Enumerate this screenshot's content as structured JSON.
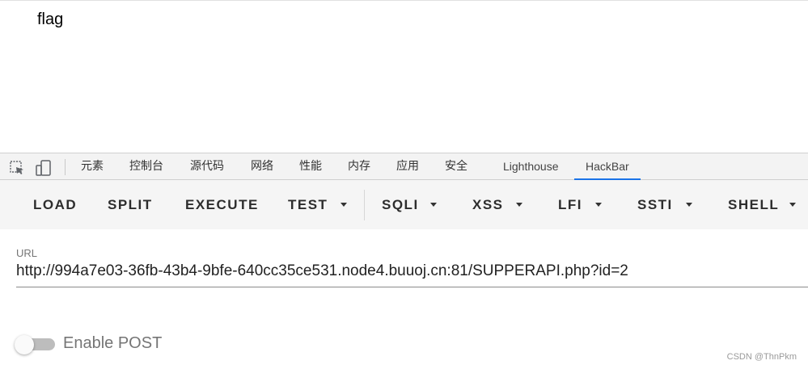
{
  "page": {
    "content_text": "flag"
  },
  "devtools": {
    "icons": [
      "inspect-element-icon",
      "device-toolbar-icon"
    ],
    "tabs": [
      {
        "label": "元素"
      },
      {
        "label": "控制台"
      },
      {
        "label": "源代码"
      },
      {
        "label": "网络"
      },
      {
        "label": "性能"
      },
      {
        "label": "内存"
      },
      {
        "label": "应用"
      },
      {
        "label": "安全"
      },
      {
        "label": "Lighthouse"
      },
      {
        "label": "HackBar",
        "active": true
      }
    ],
    "accent_color": "#1a73e8"
  },
  "hackbar": {
    "buttons": [
      {
        "label": "LOAD"
      },
      {
        "label": "SPLIT"
      },
      {
        "label": "EXECUTE"
      },
      {
        "label": "TEST",
        "dropdown": true
      },
      {
        "label": "SQLI",
        "dropdown": true
      },
      {
        "label": "XSS",
        "dropdown": true
      },
      {
        "label": "LFI",
        "dropdown": true
      },
      {
        "label": "SSTI",
        "dropdown": true
      },
      {
        "label": "SHELL",
        "dropdown": true
      }
    ],
    "url_label": "URL",
    "url_value": "http://994a7e03-36fb-43b4-9bfe-640cc35ce531.node4.buuoj.cn:81/SUPPERAPI.php?id=2",
    "enable_post_label": "Enable POST",
    "enable_post_on": false
  },
  "watermark": "CSDN @ThnPkm"
}
